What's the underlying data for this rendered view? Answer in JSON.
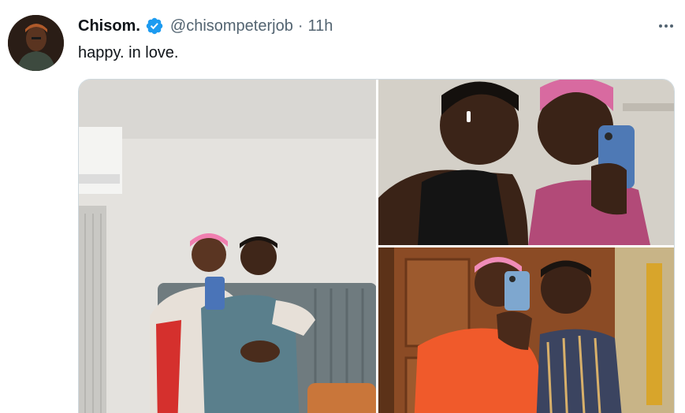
{
  "tweet": {
    "display_name": "Chisom.",
    "handle": "@chisompeterjob",
    "separator": "·",
    "time": "11h",
    "text": "happy. in love."
  },
  "icons": {
    "verified": "verified-badge-icon",
    "more": "more-dots-icon"
  },
  "colors": {
    "verified_blue": "#1d9bf0",
    "secondary_text": "#536471",
    "primary_text": "#0f1419",
    "border": "#cfd9de"
  }
}
